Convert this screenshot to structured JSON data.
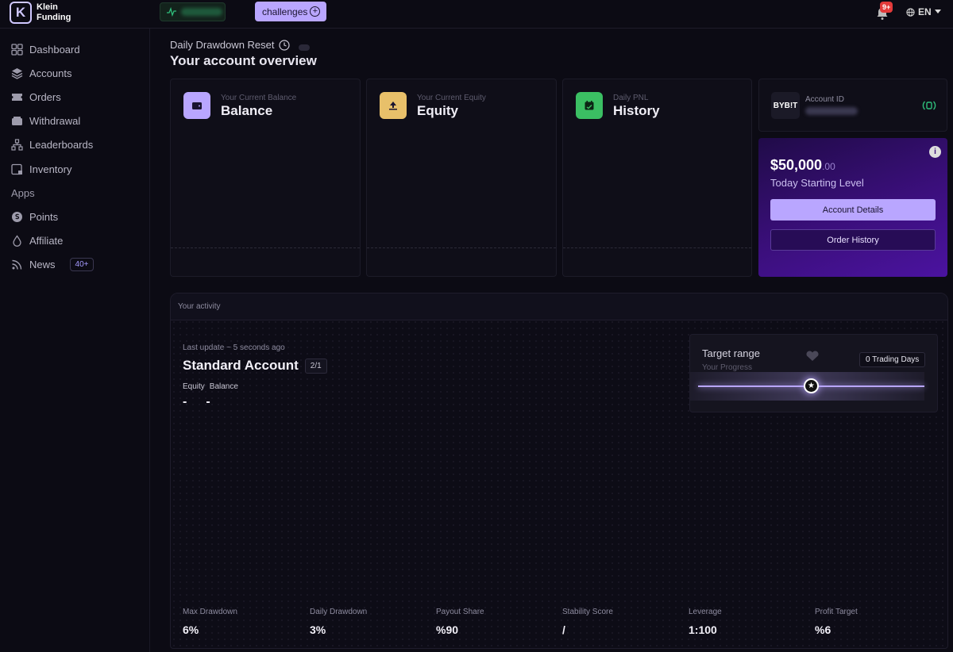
{
  "brand": {
    "line1": "Klein",
    "line2": "Funding",
    "logo_letter": "K"
  },
  "topbar": {
    "challenges_label": "challenges",
    "challenges_plus": "+",
    "notifications_badge": "9+",
    "language": "EN"
  },
  "sidebar": {
    "items": [
      {
        "label": "Dashboard",
        "icon": "grid-icon"
      },
      {
        "label": "Accounts",
        "icon": "layers-icon"
      },
      {
        "label": "Orders",
        "icon": "ticket-icon"
      },
      {
        "label": "Withdrawal",
        "icon": "wallet-icon"
      },
      {
        "label": "Leaderboards",
        "icon": "hierarchy-icon"
      },
      {
        "label": "Inventory",
        "icon": "inventory-icon"
      }
    ],
    "section_apps": "Apps",
    "apps": [
      {
        "label": "Points",
        "icon": "coin-icon"
      },
      {
        "label": "Affiliate",
        "icon": "drop-icon"
      },
      {
        "label": "News",
        "icon": "rss-icon",
        "badge": "40+"
      }
    ]
  },
  "header": {
    "reset_label": "Daily Drawdown Reset",
    "title": "Your account overview"
  },
  "cards": {
    "balance": {
      "sub": "Your Current Balance",
      "title": "Balance",
      "color": "#b9a6ff"
    },
    "equity": {
      "sub": "Your Current Equity",
      "title": "Equity",
      "color": "#e8c06a"
    },
    "history": {
      "sub": "Daily PNL",
      "title": "History",
      "color": "#3bbf63"
    }
  },
  "account": {
    "exchange": "BYB!T",
    "id_label": "Account ID"
  },
  "starting": {
    "info": "i",
    "amount": "$50,000",
    "cents": ".00",
    "label": "Today Starting Level",
    "details_button": "Account Details",
    "history_button": "Order History"
  },
  "activity": {
    "heading": "Your activity",
    "last_update": "Last update ~ 5 seconds ago",
    "account_name": "Standard Account",
    "account_badge": "2/1",
    "equity_label": "Equity",
    "balance_label": "Balance",
    "equity_value": "-",
    "balance_value": "-",
    "target": {
      "title": "Target range",
      "subtitle": "Your Progress",
      "trading_days": "0 Trading Days",
      "progress": 0.5
    },
    "metrics": [
      {
        "label": "Max Drawdown",
        "value": "6%"
      },
      {
        "label": "Daily Drawdown",
        "value": "3%"
      },
      {
        "label": "Payout Share",
        "value": "%90"
      },
      {
        "label": "Stability Score",
        "value": "/"
      },
      {
        "label": "Leverage",
        "value": "1:100"
      },
      {
        "label": "Profit Target",
        "value": "%6"
      }
    ]
  }
}
